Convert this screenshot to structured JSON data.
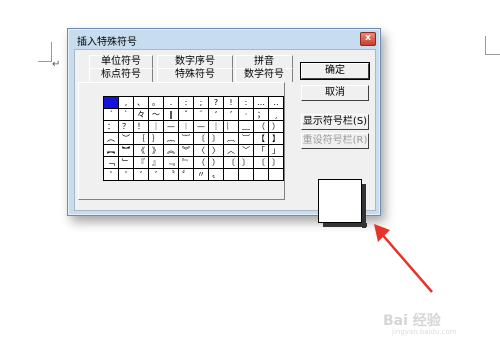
{
  "dialog": {
    "title": "插入特殊符号",
    "close_label": "x",
    "tabs_back": [
      "单位符号",
      "数字序号",
      "拼音"
    ],
    "tabs_front": [
      "标点符号",
      "特殊符号",
      "数学符号"
    ],
    "buttons": {
      "ok": "确定",
      "cancel": "取消",
      "show_bar": "显示符号栏(S)",
      "reset_bar": "重设符号栏(R)"
    },
    "symbols": [
      [
        "",
        ",",
        "、",
        "。",
        ".",
        ":",
        ";",
        "?",
        "!",
        ":",
        "…",
        "‥"
      ],
      [
        "ˊ",
        "ˋ",
        "々",
        "～",
        "‖",
        "ˇ",
        "¨",
        "‘",
        "’",
        "·",
        "；",
        "¸"
      ],
      [
        "：",
        "？",
        "！",
        "｜",
        "—",
        "︱",
        "—",
        "｜",
        "︴",
        "﹏",
        "（",
        "）"
      ],
      [
        "︵",
        "︶",
        "｛",
        "｝",
        "︷",
        "︸",
        "〔",
        "〕",
        "︹",
        "︺",
        "【",
        "】"
      ],
      [
        "︻",
        "︼",
        "《",
        "》",
        "︽",
        "︾",
        "〈",
        "〉",
        "︿",
        "﹀",
        "「",
        "」"
      ],
      [
        "﹁",
        "﹂",
        "『",
        "』",
        "﹃",
        "﹄",
        "（",
        "）",
        "〔",
        "〕",
        "〔",
        "〕"
      ],
      [
        "'",
        "'",
        "‘",
        "’",
        "〝",
        "〞",
        "〃",
        "〟",
        "",
        "",
        "",
        ""
      ]
    ],
    "selected_symbol_index": [
      0,
      0
    ]
  },
  "colors": {
    "dialog_frame": "#c7dcef",
    "selection": "#1414d8",
    "arrow": "#e8332a",
    "close_button": "#c8402c"
  },
  "watermark": {
    "main": "Bai 经验",
    "sub": "jingyan.baidu.com"
  }
}
